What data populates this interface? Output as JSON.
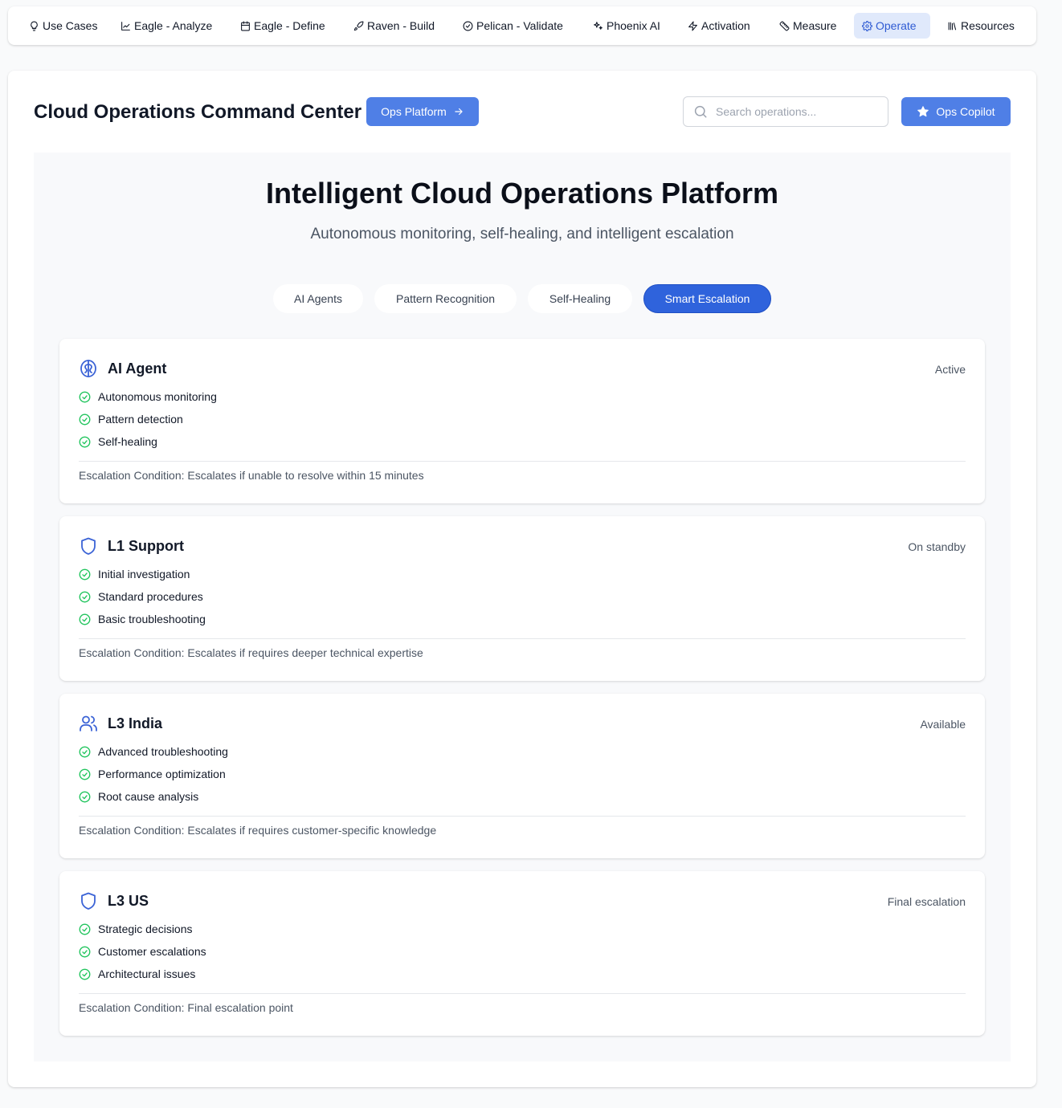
{
  "nav": {
    "items": [
      {
        "label": "Use Cases",
        "icon": "lightbulb-icon"
      },
      {
        "label": "Eagle - Analyze",
        "icon": "line-chart-icon"
      },
      {
        "label": "Eagle - Define",
        "icon": "calendar-icon"
      },
      {
        "label": "Raven - Build",
        "icon": "rocket-icon"
      },
      {
        "label": "Pelican - Validate",
        "icon": "check-circle-icon"
      },
      {
        "label": "Phoenix AI",
        "icon": "sparkles-icon"
      },
      {
        "label": "Activation",
        "icon": "zap-icon"
      },
      {
        "label": "Measure",
        "icon": "ruler-icon"
      },
      {
        "label": "Operate",
        "icon": "gear-icon",
        "active": true
      },
      {
        "label": "Resources",
        "icon": "library-icon"
      }
    ]
  },
  "header": {
    "title": "Cloud Operations Command Center",
    "ops_platform_label": "Ops Platform",
    "search_placeholder": "Search operations...",
    "copilot_label": "Ops Copilot"
  },
  "hero": {
    "title": "Intelligent Cloud Operations Platform",
    "subtitle": "Autonomous monitoring, self-healing, and intelligent escalation"
  },
  "tabs": [
    {
      "label": "AI Agents"
    },
    {
      "label": "Pattern Recognition"
    },
    {
      "label": "Self-Healing"
    },
    {
      "label": "Smart Escalation",
      "active": true
    }
  ],
  "tiers": [
    {
      "title": "AI Agent",
      "icon": "brain-icon",
      "status": "Active",
      "features": [
        "Autonomous monitoring",
        "Pattern detection",
        "Self-healing"
      ],
      "escalation": "Escalation Condition: Escalates if unable to resolve within 15 minutes"
    },
    {
      "title": "L1 Support",
      "icon": "shield-icon",
      "status": "On standby",
      "features": [
        "Initial investigation",
        "Standard procedures",
        "Basic troubleshooting"
      ],
      "escalation": "Escalation Condition: Escalates if requires deeper technical expertise"
    },
    {
      "title": "L3 India",
      "icon": "users-icon",
      "status": "Available",
      "features": [
        "Advanced troubleshooting",
        "Performance optimization",
        "Root cause analysis"
      ],
      "escalation": "Escalation Condition: Escalates if requires customer-specific knowledge"
    },
    {
      "title": "L3 US",
      "icon": "shield-icon",
      "status": "Final escalation",
      "features": [
        "Strategic decisions",
        "Customer escalations",
        "Architectural issues"
      ],
      "escalation": "Escalation Condition: Final escalation point"
    }
  ],
  "colors": {
    "accent": "#4f7fe6",
    "active_tab": "#2f63dc",
    "check": "#22c55e",
    "tier_icon": "#3b63d6"
  }
}
